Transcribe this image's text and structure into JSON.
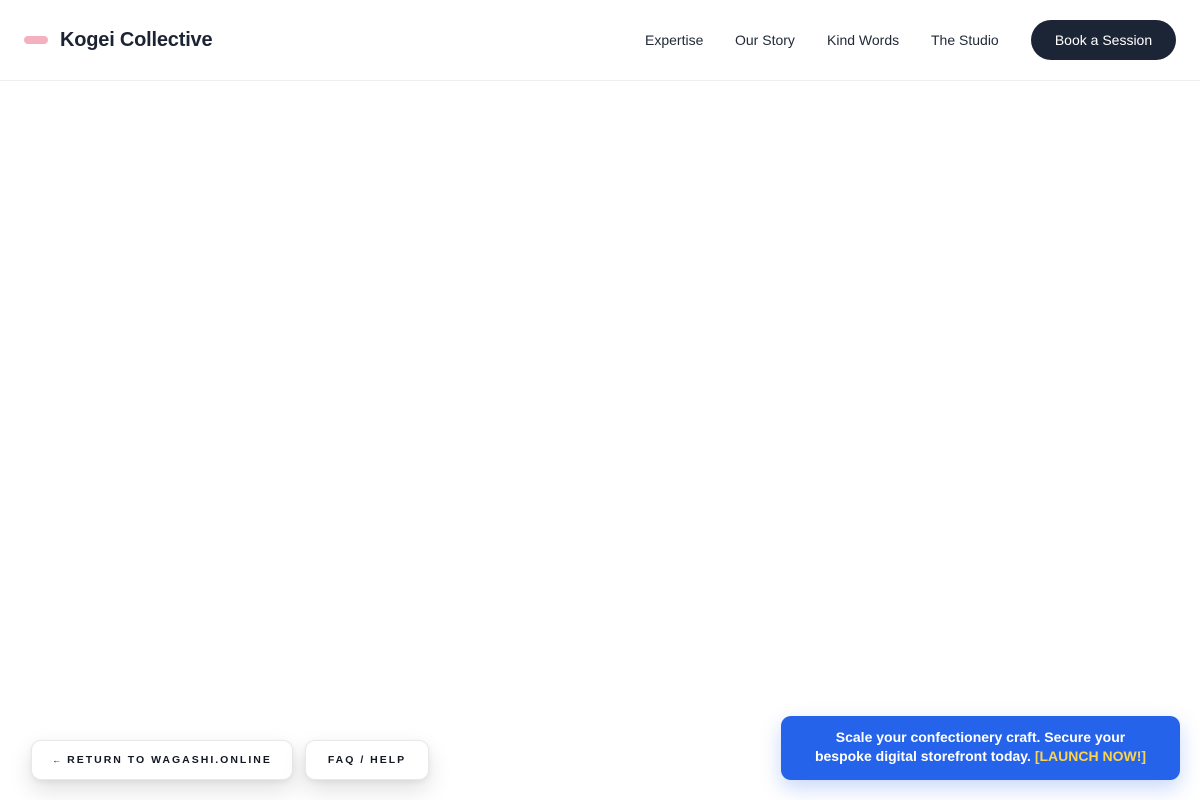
{
  "header": {
    "brand_name": "Kogei Collective",
    "nav": [
      {
        "label": "Expertise"
      },
      {
        "label": "Our Story"
      },
      {
        "label": "Kind Words"
      },
      {
        "label": "The Studio"
      }
    ],
    "cta_label": "Book a Session"
  },
  "footer_actions": {
    "return_arrow": "←",
    "return_label": "RETURN TO WAGASHI.ONLINE",
    "faq_label": "FAQ / HELP"
  },
  "promo": {
    "line1": "Scale your confectionery craft. Secure your",
    "line2": "bespoke digital storefront today.",
    "launch_label": "[LAUNCH NOW!]"
  },
  "colors": {
    "brand_mark": "#f5b0c0",
    "cta_bg": "#1c2535",
    "promo_bg": "#2563eb",
    "promo_highlight": "#fcd34d"
  }
}
